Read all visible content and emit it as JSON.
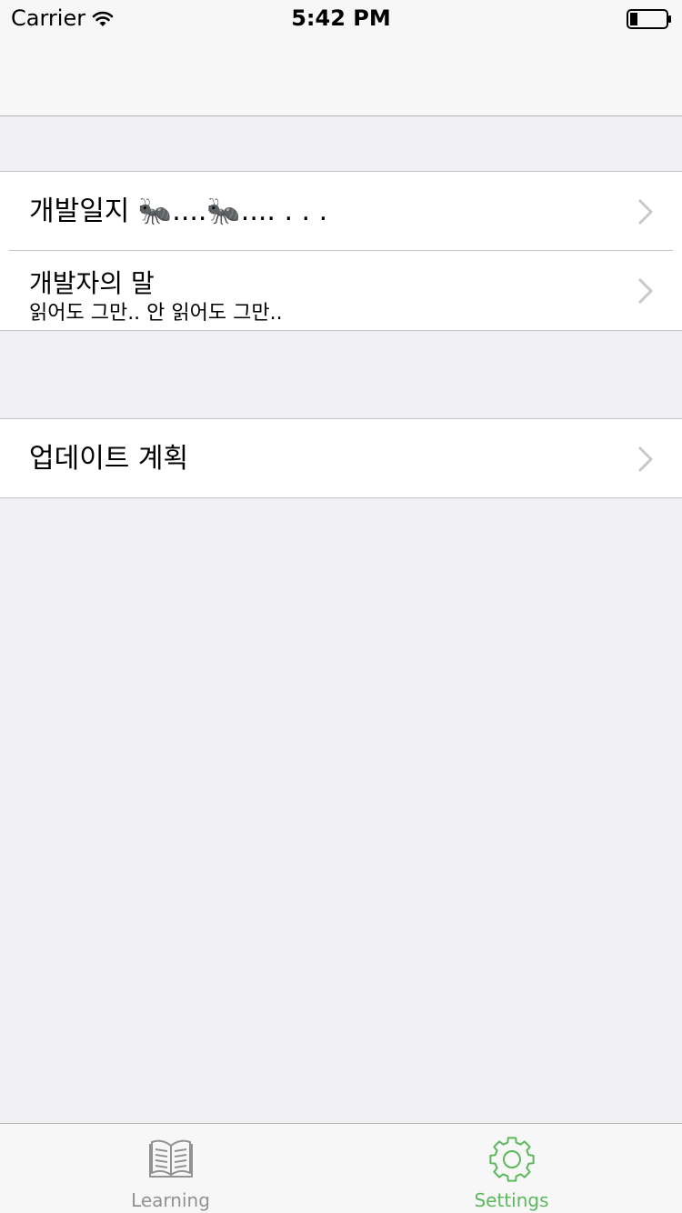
{
  "status_bar": {
    "carrier": "Carrier",
    "time": "5:42 PM"
  },
  "sections": [
    {
      "rows": [
        {
          "title": "개발일지 🐜....🐜.... . .   ."
        },
        {
          "title": "개발자의 말",
          "subtitle": "읽어도 그만.. 안 읽어도 그만.."
        }
      ]
    },
    {
      "rows": [
        {
          "title": "업데이트 계획"
        }
      ]
    }
  ],
  "tab_bar": {
    "tabs": [
      {
        "label": "Learning",
        "icon": "book-icon",
        "selected": false
      },
      {
        "label": "Settings",
        "icon": "gear-icon",
        "selected": true
      }
    ],
    "active_color": "#5cb85c",
    "inactive_color": "#929292"
  }
}
